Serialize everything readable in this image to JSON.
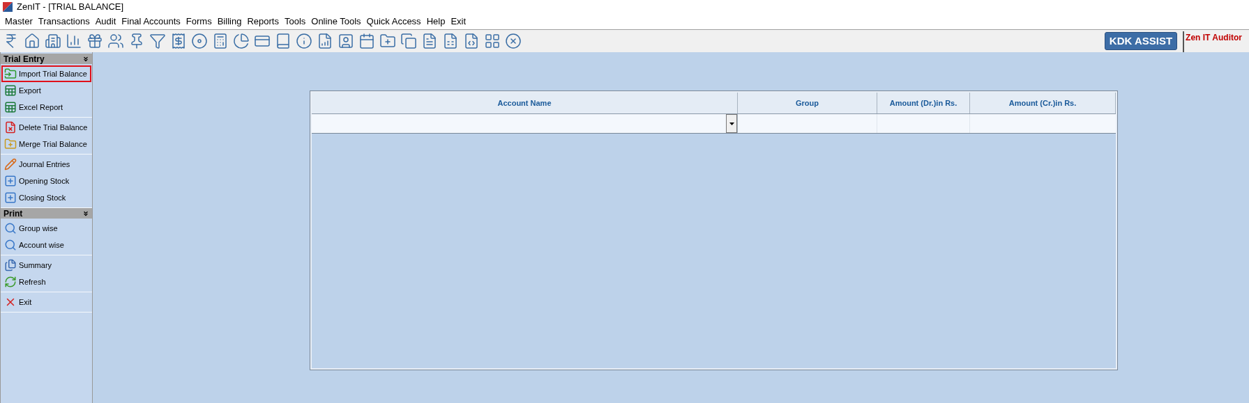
{
  "window": {
    "title": "ZenIT - [TRIAL BALANCE]"
  },
  "menu": [
    "Master",
    "Transactions",
    "Audit",
    "Final Accounts",
    "Forms",
    "Billing",
    "Reports",
    "Tools",
    "Online Tools",
    "Quick Access",
    "Help",
    "Exit"
  ],
  "toolbar": {
    "assist_button": "KDK ASSIST",
    "brand": "Zen IT Auditor"
  },
  "sidebar": {
    "sections": [
      {
        "title": "Trial Entry",
        "groups": [
          [
            {
              "label": "Import Trial Balance",
              "kind": "import",
              "selected": true
            },
            {
              "label": "Export",
              "kind": "excel",
              "selected": false
            },
            {
              "label": "Excel Report",
              "kind": "excel",
              "selected": false
            }
          ],
          [
            {
              "label": "Delete Trial Balance",
              "kind": "delete",
              "selected": false
            },
            {
              "label": "Merge Trial Balance",
              "kind": "merge",
              "selected": false
            }
          ],
          [
            {
              "label": "Journal Entries",
              "kind": "journal",
              "selected": false
            },
            {
              "label": "Opening Stock",
              "kind": "stock",
              "selected": false
            },
            {
              "label": "Closing Stock",
              "kind": "stock",
              "selected": false
            }
          ]
        ]
      },
      {
        "title": "Print",
        "groups": [
          [
            {
              "label": "Group wise",
              "kind": "print",
              "selected": false
            },
            {
              "label": "Account wise",
              "kind": "print",
              "selected": false
            }
          ],
          [
            {
              "label": "Summary",
              "kind": "summary",
              "selected": false
            },
            {
              "label": "Refresh",
              "kind": "refresh",
              "selected": false
            }
          ],
          [
            {
              "label": "Exit",
              "kind": "exit",
              "selected": false
            }
          ]
        ]
      }
    ]
  },
  "table": {
    "columns": [
      "Account Name",
      "Group",
      "Amount (Dr.)in Rs.",
      "Amount (Cr.)in Rs."
    ]
  }
}
